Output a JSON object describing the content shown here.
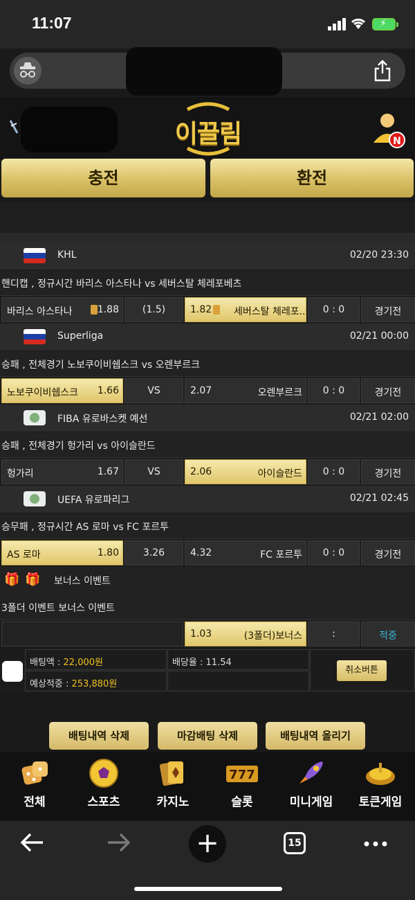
{
  "status_bar": {
    "time": "11:07"
  },
  "site": {
    "logo_text": "이끌림",
    "profile_badge": "N",
    "charge_button": "충전",
    "exchange_button": "환전"
  },
  "games": [
    {
      "league": "KHL",
      "flag": "russia",
      "datetime": "02/20 23:30",
      "market": "핸디캡 , 정규시간 바리스 아스타나  vs  세버스탈 체레포베츠",
      "home": "바리스 아스타나",
      "home_odds": "1.88",
      "middle": "(1.5)",
      "away_odds": "1.82",
      "away": "세버스탈 체레포..",
      "score": "0 : 0",
      "status": "경기전",
      "selected": "away"
    },
    {
      "league": "Superliga",
      "flag": "russia",
      "datetime": "02/21 00:00",
      "market": "승패 , 전체경기 노보쿠이비쉡스크  vs  오렌부르크",
      "home": "노보쿠이비쉡스크",
      "home_odds": "1.66",
      "middle": "VS",
      "away_odds": "2.07",
      "away": "오렌부르크",
      "score": "0 : 0",
      "status": "경기전",
      "selected": "home"
    },
    {
      "league": "FIBA 유로바스켓 예선",
      "flag": "globe",
      "datetime": "02/21 02:00",
      "market": "승패 , 전체경기 헝가리  vs  아이슬란드",
      "home": "헝가리",
      "home_odds": "1.67",
      "middle": "VS",
      "away_odds": "2.06",
      "away": "아이슬란드",
      "score": "0 : 0",
      "status": "경기전",
      "selected": "away"
    },
    {
      "league": "UEFA 유로파리그",
      "flag": "globe",
      "datetime": "02/21 02:45",
      "market": "승무패 , 정규시간 AS 로마  vs  FC 포르투",
      "home": "AS 로마",
      "home_odds": "1.80",
      "middle": "3.26",
      "away_odds": "4.32",
      "away": "FC 포르투",
      "score": "0 : 0",
      "status": "경기전",
      "selected": "home"
    }
  ],
  "bonus": {
    "header": "보너스 이벤트",
    "market": "3폴더 이벤트 보너스 이벤트",
    "odds": "1.03",
    "label": "(3폴더)보너스",
    "colon": ":",
    "status": "적중"
  },
  "slip": {
    "bet_amount_label": "배팅액 : ",
    "bet_amount": "22,000원",
    "rate_label": "배당율 : ",
    "rate": "11.54",
    "expected_label": "예상적중 : ",
    "expected": "253,880원",
    "cancel_button": "취소버튼"
  },
  "actions": {
    "delete_history": "배팅내역 삭제",
    "closed_delete": "마감배팅 삭제",
    "upload_history": "배팅내역 올리기"
  },
  "categories": [
    "전체",
    "스포츠",
    "카지노",
    "슬롯",
    "미니게임",
    "토큰게임"
  ],
  "browser": {
    "tab_count": "15"
  },
  "colors": {
    "gold": "#e0c76c",
    "accent_cyan": "#3ab8d8",
    "bonus_yellow": "#f0c020"
  }
}
